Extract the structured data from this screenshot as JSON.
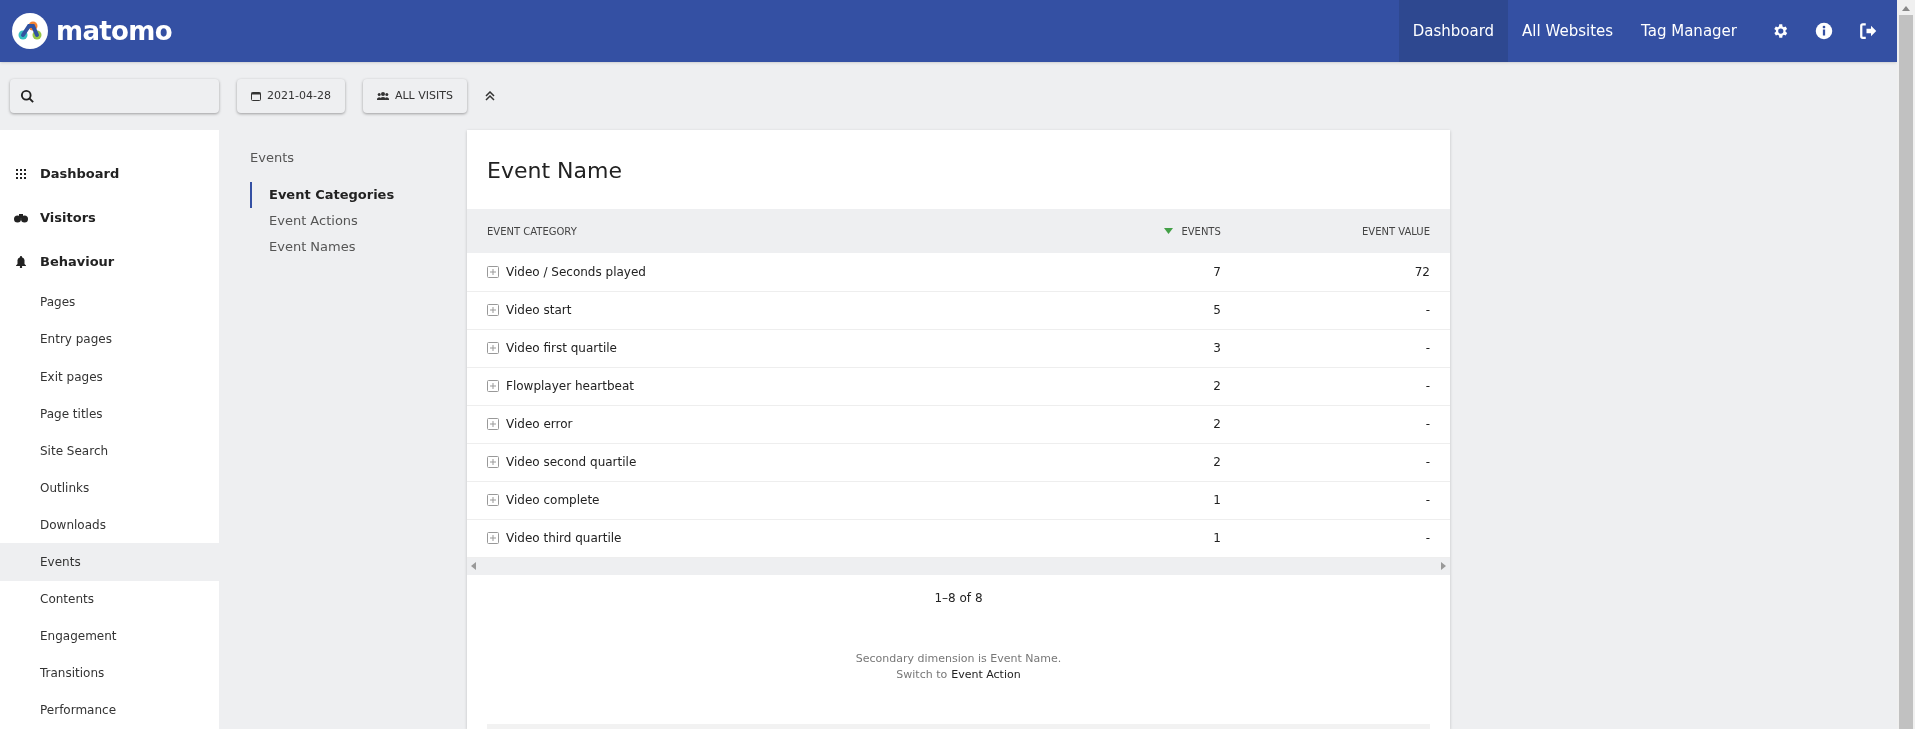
{
  "header": {
    "logo_text": "matomo",
    "nav": [
      {
        "label": "Dashboard",
        "selected": true
      },
      {
        "label": "All Websites",
        "selected": false
      },
      {
        "label": "Tag Manager",
        "selected": false
      }
    ]
  },
  "toolbar": {
    "date": "2021-04-28",
    "segment": "ALL VISITS"
  },
  "sidebar": {
    "items": [
      {
        "label": "Dashboard",
        "kind": "section",
        "selected": false
      },
      {
        "label": "Visitors",
        "kind": "section",
        "selected": false
      },
      {
        "label": "Behaviour",
        "kind": "section",
        "selected": false
      },
      {
        "label": "Pages",
        "kind": "item",
        "selected": false
      },
      {
        "label": "Entry pages",
        "kind": "item",
        "selected": false
      },
      {
        "label": "Exit pages",
        "kind": "item",
        "selected": false
      },
      {
        "label": "Page titles",
        "kind": "item",
        "selected": false
      },
      {
        "label": "Site Search",
        "kind": "item",
        "selected": false
      },
      {
        "label": "Outlinks",
        "kind": "item",
        "selected": false
      },
      {
        "label": "Downloads",
        "kind": "item",
        "selected": false
      },
      {
        "label": "Events",
        "kind": "item",
        "selected": true
      },
      {
        "label": "Contents",
        "kind": "item",
        "selected": false
      },
      {
        "label": "Engagement",
        "kind": "item",
        "selected": false
      },
      {
        "label": "Transitions",
        "kind": "item",
        "selected": false
      },
      {
        "label": "Performance",
        "kind": "item",
        "selected": false
      }
    ]
  },
  "subnav": {
    "title": "Events",
    "items": [
      {
        "label": "Event Categories",
        "selected": true
      },
      {
        "label": "Event Actions",
        "selected": false
      },
      {
        "label": "Event Names",
        "selected": false
      }
    ]
  },
  "report": {
    "title": "Event Name",
    "table": {
      "columns": [
        {
          "label": "EVENT CATEGORY",
          "sorted": false
        },
        {
          "label": "EVENTS",
          "sorted": true
        },
        {
          "label": "EVENT VALUE",
          "sorted": false
        }
      ],
      "rows": [
        [
          "Video / Seconds played",
          "7",
          "72"
        ],
        [
          "Video start",
          "5",
          "-"
        ],
        [
          "Video first quartile",
          "3",
          "-"
        ],
        [
          "Flowplayer heartbeat",
          "2",
          "-"
        ],
        [
          "Video error",
          "2",
          "-"
        ],
        [
          "Video second quartile",
          "2",
          "-"
        ],
        [
          "Video complete",
          "1",
          "-"
        ],
        [
          "Video third quartile",
          "1",
          "-"
        ]
      ]
    },
    "pagination": "1–8 of 8",
    "secondary_text": "Secondary dimension is Event Name.",
    "switch_prefix": "Switch to",
    "switch_link": "Event Action"
  }
}
